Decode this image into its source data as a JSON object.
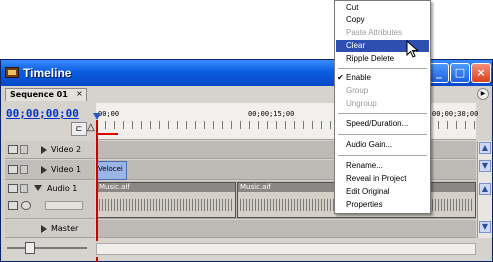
{
  "window": {
    "title": "Timeline"
  },
  "tab": {
    "label": "Sequence 01",
    "close": "×"
  },
  "timecode": "00;00;00;00",
  "ruler": {
    "labels": [
      "00;00",
      "00;00;15;00",
      "00;00;30;00"
    ]
  },
  "tracks": {
    "video2": {
      "name": "Video 2"
    },
    "video1": {
      "name": "Video 1",
      "clip": "Velocei"
    },
    "audio1": {
      "name": "Audio 1",
      "clips": [
        "Music.aif",
        "Music.aif"
      ]
    },
    "master": {
      "name": "Master"
    }
  },
  "menu": {
    "items": [
      {
        "label": "Cut",
        "disabled": false
      },
      {
        "label": "Copy",
        "disabled": false
      },
      {
        "label": "Paste Attributes",
        "disabled": true
      },
      {
        "label": "Clear",
        "disabled": false,
        "highlighted": true
      },
      {
        "label": "Ripple Delete",
        "disabled": false
      },
      {
        "label": "Enable",
        "disabled": false,
        "checked": true
      },
      {
        "label": "Group",
        "disabled": true
      },
      {
        "label": "Ungroup",
        "disabled": true
      },
      {
        "label": "Speed/Duration...",
        "disabled": false
      },
      {
        "label": "Audio Gain...",
        "disabled": false
      },
      {
        "label": "Rename...",
        "disabled": false
      },
      {
        "label": "Reveal in Project",
        "disabled": false
      },
      {
        "label": "Edit Original",
        "disabled": false
      },
      {
        "label": "Properties",
        "disabled": false
      }
    ]
  },
  "colors": {
    "titlebar": "#0a5ee0",
    "menu_highlight": "#2f4fb0",
    "timecode": "#0033cc",
    "playhead": "#d00000"
  }
}
